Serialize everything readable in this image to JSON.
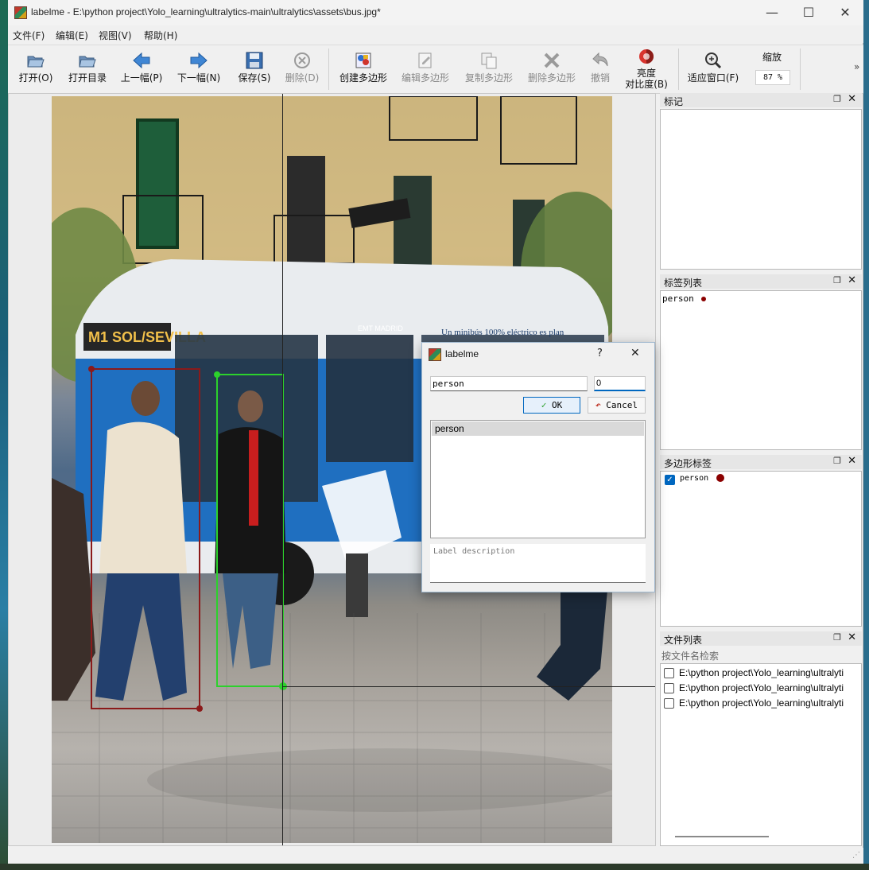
{
  "window": {
    "title": "labelme - E:\\python project\\Yolo_learning\\ultralytics-main\\ultralytics\\assets\\bus.jpg*",
    "controls": [
      "—",
      "☐",
      "✕"
    ]
  },
  "menu": [
    "文件(F)",
    "编辑(E)",
    "视图(V)",
    "帮助(H)"
  ],
  "toolbar": {
    "open": "打开(O)",
    "open_dir": "打开目录",
    "prev": "上一幅(P)",
    "next": "下一幅(N)",
    "save": "保存(S)",
    "delete": "删除(D)",
    "create_polygon": "创建多边形",
    "edit_polygon": "编辑多边形",
    "copy_polygon": "复制多边形",
    "delete_polygon": "删除多边形",
    "undo": "撤销",
    "brightness_1": "亮度",
    "brightness_2": "对比度(B)",
    "fit_window": "适应窗口(F)",
    "zoom_label": "缩放",
    "zoom_value": "87 %",
    "overflow": "»"
  },
  "docks": {
    "flags": {
      "title": "标记"
    },
    "label_list": {
      "title": "标签列表",
      "items": [
        {
          "label": "person",
          "color": "#8b0000"
        }
      ]
    },
    "polygon_labels": {
      "title": "多边形标签",
      "items": [
        {
          "label": "person",
          "checked": true,
          "color": "#8b0000"
        }
      ]
    },
    "file_list": {
      "title": "文件列表",
      "search_placeholder": "按文件名检索",
      "files": [
        "E:\\python project\\Yolo_learning\\ultralyti",
        "E:\\python project\\Yolo_learning\\ultralyti",
        "E:\\python project\\Yolo_learning\\ultralyti"
      ]
    }
  },
  "dialog": {
    "title": "labelme",
    "help": "?",
    "close": "✕",
    "label_value": "person",
    "group_id": "0",
    "ok": "OK",
    "cancel": "Cancel",
    "list": [
      "person"
    ],
    "description_placeholder": "Label description"
  },
  "canvas_text": {
    "bus_destination": "M1 SOL/SEVILLA",
    "bus_side": "Un minibús 100% eléctrico es plan",
    "bus_brand": "EMT MADRID"
  },
  "colors": {
    "box_person_1": "#8b1a1a",
    "box_person_2": "#22cc22",
    "accent": "#0078d4"
  }
}
